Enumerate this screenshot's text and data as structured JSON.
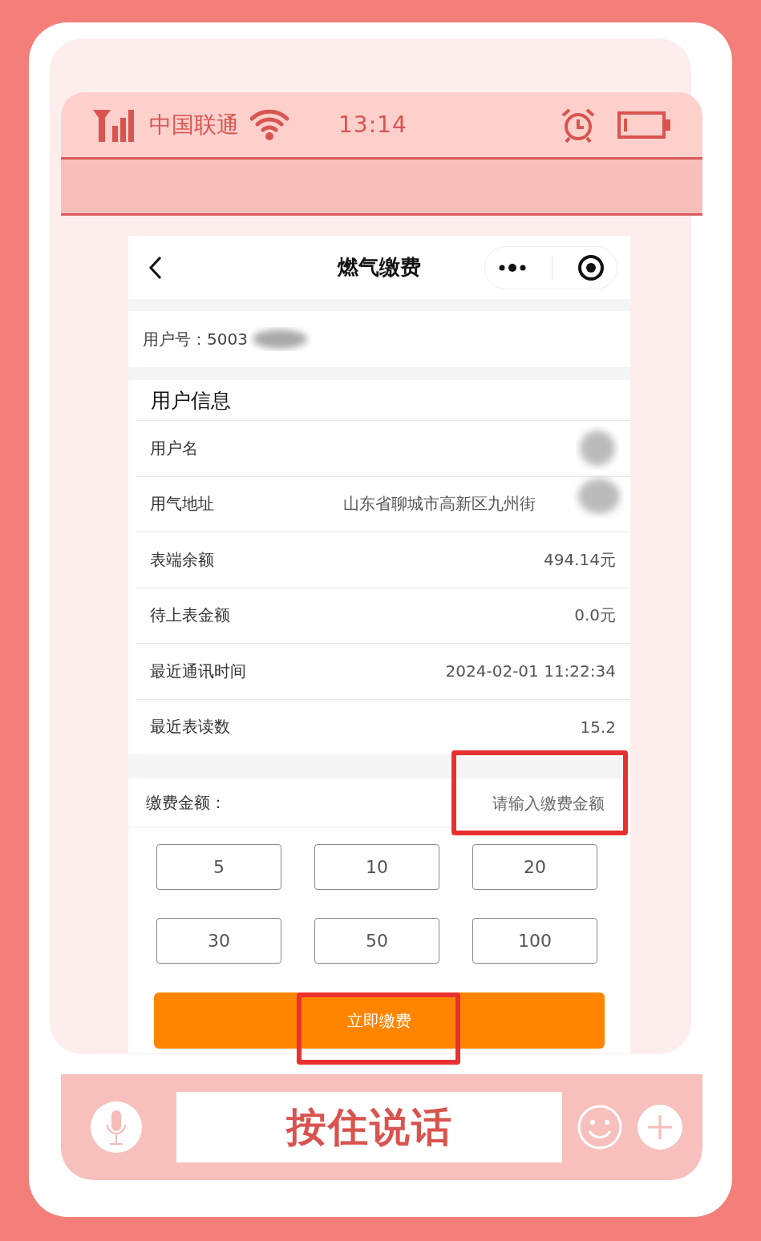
{
  "status_bar": {
    "carrier": "中国联通",
    "time": "13:14"
  },
  "mini_program": {
    "title": "燃气缴费",
    "account": {
      "label": "用户号：",
      "value": "5003"
    },
    "info": {
      "title": "用户信息",
      "rows": [
        {
          "kind": "text",
          "label": "用户名"
        },
        {
          "kind": "address",
          "label": "用气地址",
          "value": "山东省聊城市高新区九州街"
        },
        {
          "kind": "text",
          "label": "表端余额",
          "value": "494.14元"
        },
        {
          "kind": "text",
          "label": "待上表金额",
          "value": "0.0元"
        },
        {
          "kind": "text",
          "label": "最近通讯时间",
          "value": "2024-02-01 11:22:34"
        },
        {
          "kind": "text",
          "label": "最近表读数",
          "value": "15.2"
        }
      ]
    },
    "payment": {
      "label": "缴费金额：",
      "placeholder": "请输入缴费金额",
      "amounts": [
        "5",
        "10",
        "20",
        "30",
        "50",
        "100"
      ],
      "submit": "立即缴费"
    }
  },
  "voice_bar": {
    "hold_to_talk": "按住说话"
  }
}
